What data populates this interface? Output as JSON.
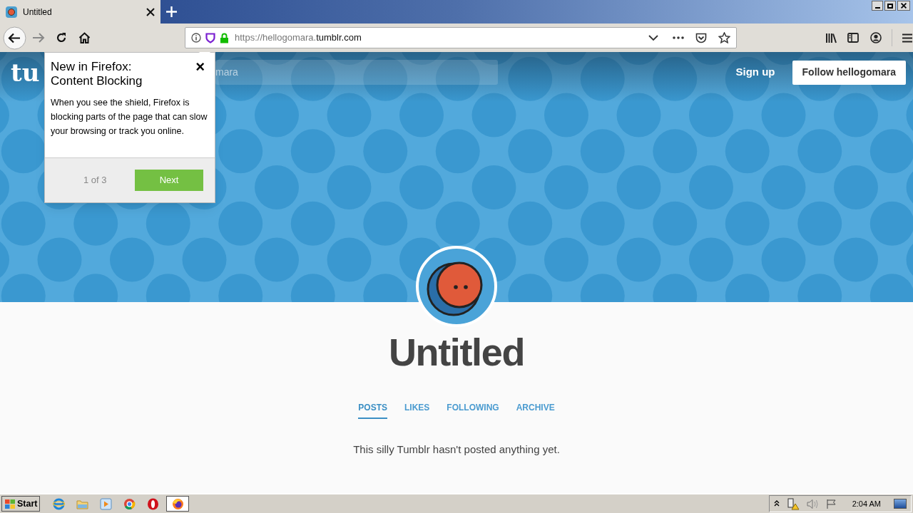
{
  "browser": {
    "tab": {
      "title": "Untitled",
      "selected": true
    },
    "url": {
      "prefix": "https://hellogomara.",
      "domain": "tumblr.com"
    }
  },
  "site": {
    "logo": "tu",
    "search": {
      "value": "mara"
    },
    "sign_up": "Sign up",
    "follow": "Follow hellogomara"
  },
  "popup": {
    "title": "New in Firefox: Content Blocking",
    "body": "When you see the shield, Firefox is blocking parts of the page that can slow your browsing or track you online.",
    "step": "1 of 3",
    "next": "Next",
    "close": "×"
  },
  "blog": {
    "title": "Untitled",
    "tabs": [
      {
        "label": "POSTS",
        "selected": true
      },
      {
        "label": "LIKES",
        "selected": false
      },
      {
        "label": "FOLLOWING",
        "selected": false
      },
      {
        "label": "ARCHIVE",
        "selected": false
      }
    ],
    "message": "This silly Tumblr hasn't posted anything yet."
  },
  "taskbar": {
    "start": "Start",
    "clock": "2:04 AM"
  }
}
